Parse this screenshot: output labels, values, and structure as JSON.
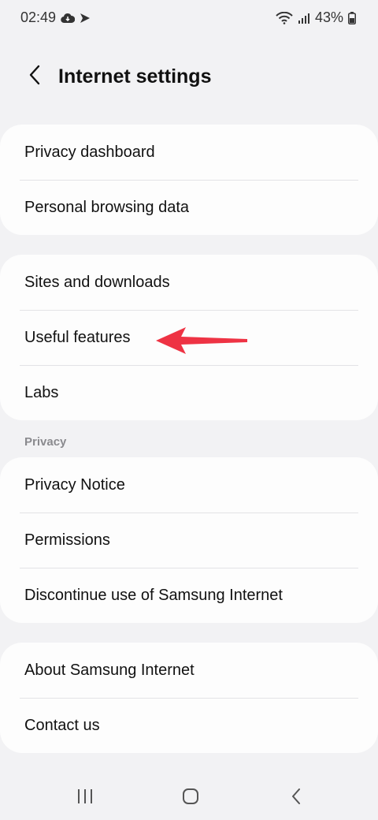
{
  "status_bar": {
    "time": "02:49",
    "battery_percent": "43%"
  },
  "header": {
    "title": "Internet settings"
  },
  "groups": [
    {
      "items": [
        {
          "label": "Privacy dashboard"
        },
        {
          "label": "Personal browsing data"
        }
      ]
    },
    {
      "items": [
        {
          "label": "Sites and downloads"
        },
        {
          "label": "Useful features"
        },
        {
          "label": "Labs"
        }
      ]
    },
    {
      "header": "Privacy",
      "items": [
        {
          "label": "Privacy Notice"
        },
        {
          "label": "Permissions"
        },
        {
          "label": "Discontinue use of Samsung Internet"
        }
      ]
    },
    {
      "items": [
        {
          "label": "About Samsung Internet"
        },
        {
          "label": "Contact us"
        }
      ]
    }
  ],
  "annotation": {
    "type": "arrow",
    "color": "#ee3344",
    "points_to": "Useful features"
  },
  "nav_bar": {
    "buttons": [
      "recent-apps",
      "home",
      "back"
    ]
  }
}
